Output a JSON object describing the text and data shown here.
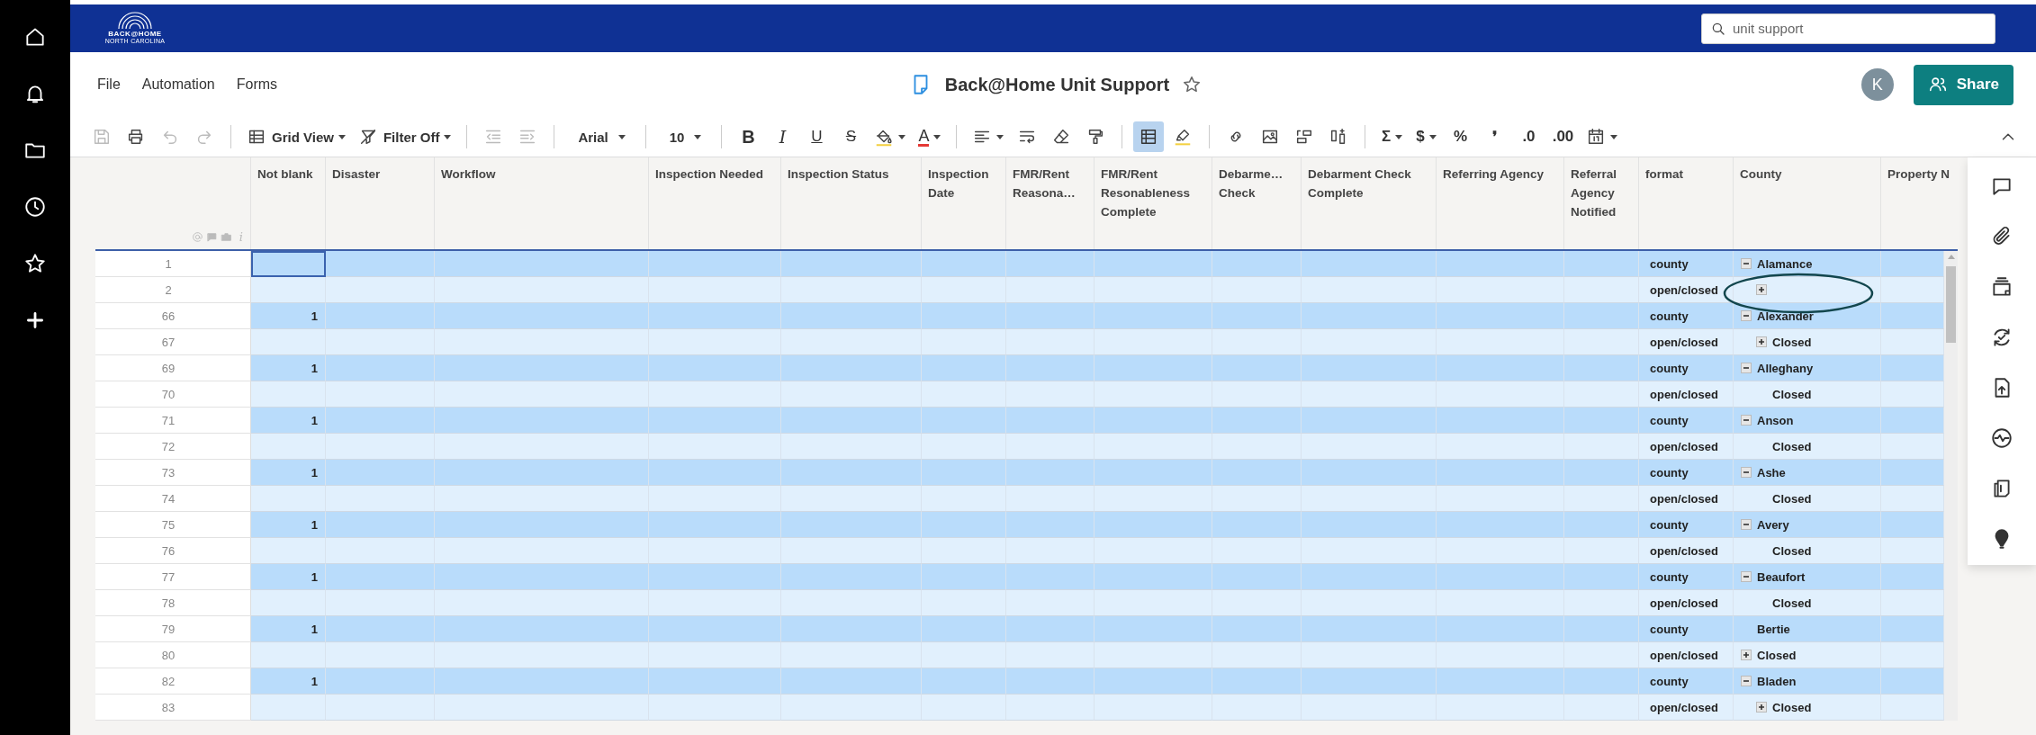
{
  "logo": {
    "text": "BACK@HOME",
    "subtitle": "NORTH CAROLINA"
  },
  "search": {
    "value": "unit support"
  },
  "menu": [
    "File",
    "Automation",
    "Forms"
  ],
  "title": "Back@Home Unit Support",
  "avatar": "K",
  "share_button": "Share",
  "toolbar": [
    {
      "kind": "icon",
      "disabled": true,
      "on": false
    },
    {
      "kind": "icon",
      "disabled": false,
      "on": false
    },
    {
      "kind": "icon",
      "disabled": true,
      "on": false
    },
    {
      "kind": "icon",
      "disabled": true,
      "on": false
    },
    {
      "kind": "separator"
    },
    {
      "kind": "icon-label-menu",
      "label": "Grid View",
      "disabled": false,
      "on": false
    },
    {
      "kind": "icon-label-menu",
      "label": "Filter Off",
      "disabled": false,
      "on": false
    },
    {
      "kind": "separator"
    },
    {
      "kind": "icon",
      "disabled": true,
      "on": false
    },
    {
      "kind": "icon",
      "disabled": true,
      "on": false
    },
    {
      "kind": "separator"
    },
    {
      "kind": "label-menu",
      "label": "Arial",
      "disabled": false,
      "on": false
    },
    {
      "kind": "separator"
    },
    {
      "kind": "label-menu",
      "label": "10",
      "disabled": false,
      "on": false
    },
    {
      "kind": "separator"
    },
    {
      "kind": "bold",
      "label": "B",
      "disabled": false,
      "on": false
    },
    {
      "kind": "italic",
      "label": "I",
      "disabled": false,
      "on": false
    },
    {
      "kind": "underline",
      "label": "U",
      "disabled": false,
      "on": false
    },
    {
      "kind": "strike",
      "label": "S",
      "disabled": false,
      "on": false
    },
    {
      "kind": "icon-menu",
      "disabled": false,
      "on": false
    },
    {
      "kind": "textcolor",
      "label": "A",
      "disabled": false,
      "on": false
    },
    {
      "kind": "separator"
    },
    {
      "kind": "icon-menu",
      "disabled": false,
      "on": false
    },
    {
      "kind": "icon",
      "disabled": false,
      "on": false
    },
    {
      "kind": "icon",
      "disabled": false,
      "on": false
    },
    {
      "kind": "icon",
      "disabled": false,
      "on": false
    },
    {
      "kind": "separator"
    },
    {
      "kind": "icon",
      "disabled": false,
      "on": true
    },
    {
      "kind": "icon",
      "disabled": false,
      "on": false
    },
    {
      "kind": "separator"
    },
    {
      "kind": "icon",
      "disabled": false,
      "on": false
    },
    {
      "kind": "icon",
      "disabled": false,
      "on": false
    },
    {
      "kind": "icon",
      "disabled": false,
      "on": false
    },
    {
      "kind": "icon",
      "disabled": false,
      "on": false
    },
    {
      "kind": "separator"
    },
    {
      "kind": "glyph-menu",
      "label": "Σ",
      "disabled": false,
      "on": false
    },
    {
      "kind": "glyph-menu",
      "label": "$",
      "disabled": false,
      "on": false
    },
    {
      "kind": "glyph",
      "label": "%",
      "disabled": false,
      "on": false
    },
    {
      "kind": "glyph",
      "label": "❜",
      "disabled": false,
      "on": false
    },
    {
      "kind": "glyph",
      "label": ".0",
      "disabled": false,
      "on": false
    },
    {
      "kind": "glyph",
      "label": ".00",
      "disabled": false,
      "on": false
    },
    {
      "kind": "icon-menu",
      "disabled": false,
      "on": false
    },
    {
      "kind": "icon",
      "disabled": false,
      "on": false
    }
  ],
  "table": {
    "corner_glyph": "i",
    "columns": [
      "Not blank",
      "Disaster",
      "Workflow",
      "Inspection Needed",
      "Inspection Status",
      "Inspection Date",
      "FMR/Rent Reasona…",
      "FMR/Rent Resonableness Complete",
      "Debarme… Check",
      "Debarment Check Complete",
      "Referring Agency",
      "Referral Agency Notified",
      "format",
      "County",
      "Property N"
    ],
    "rows": [
      {
        "number": "1",
        "selected": true,
        "format": "county",
        "county": {
          "text": "Alamance",
          "expanded": true
        },
        "children": [
          {
            "number": "2",
            "selected": false,
            "format": "open/closed",
            "county": {
              "expanded": false
            }
          }
        ]
      },
      {
        "number": "66",
        "not_blank": "1",
        "selected": false,
        "format": "county",
        "county": {
          "text": "Alexander",
          "expanded": true
        },
        "children": [
          {
            "number": "67",
            "selected": false,
            "format": "open/closed",
            "county": {
              "text": "Closed",
              "expanded": false
            }
          }
        ]
      },
      {
        "number": "69",
        "not_blank": "1",
        "selected": false,
        "format": "county",
        "county": {
          "text": "Alleghany",
          "expanded": true
        },
        "children": [
          {
            "number": "70",
            "selected": false,
            "format": "open/closed",
            "county": {
              "text": "Closed"
            }
          }
        ]
      },
      {
        "number": "71",
        "not_blank": "1",
        "selected": false,
        "format": "county",
        "county": {
          "text": "Anson",
          "expanded": true
        },
        "children": [
          {
            "number": "72",
            "selected": false,
            "format": "open/closed",
            "county": {
              "text": "Closed"
            }
          }
        ]
      },
      {
        "number": "73",
        "not_blank": "1",
        "selected": false,
        "format": "county",
        "county": {
          "text": "Ashe",
          "expanded": true
        },
        "children": [
          {
            "number": "74",
            "selected": false,
            "format": "open/closed",
            "county": {
              "text": "Closed"
            }
          }
        ]
      },
      {
        "number": "75",
        "not_blank": "1",
        "selected": false,
        "format": "county",
        "county": {
          "text": "Avery",
          "expanded": true
        },
        "children": [
          {
            "number": "76",
            "selected": false,
            "format": "open/closed",
            "county": {
              "text": "Closed"
            }
          }
        ]
      },
      {
        "number": "77",
        "not_blank": "1",
        "selected": false,
        "format": "county",
        "county": {
          "text": "Beaufort",
          "expanded": true
        },
        "children": [
          {
            "number": "78",
            "selected": false,
            "format": "open/closed",
            "county": {
              "text": "Closed"
            }
          }
        ]
      },
      {
        "number": "79",
        "not_blank": "1",
        "selected": false,
        "format": "county",
        "county": {
          "text": "Bertie"
        }
      },
      {
        "number": "80",
        "selected": false,
        "format": "open/closed",
        "county": {
          "text": "Closed",
          "expanded": false
        }
      },
      {
        "number": "82",
        "not_blank": "1",
        "selected": false,
        "format": "county",
        "county": {
          "text": "Bladen",
          "expanded": true
        },
        "children": [
          {
            "number": "83",
            "selected": false,
            "format": "open/closed",
            "county": {
              "text": "Closed",
              "expanded": false
            }
          }
        ]
      }
    ]
  }
}
